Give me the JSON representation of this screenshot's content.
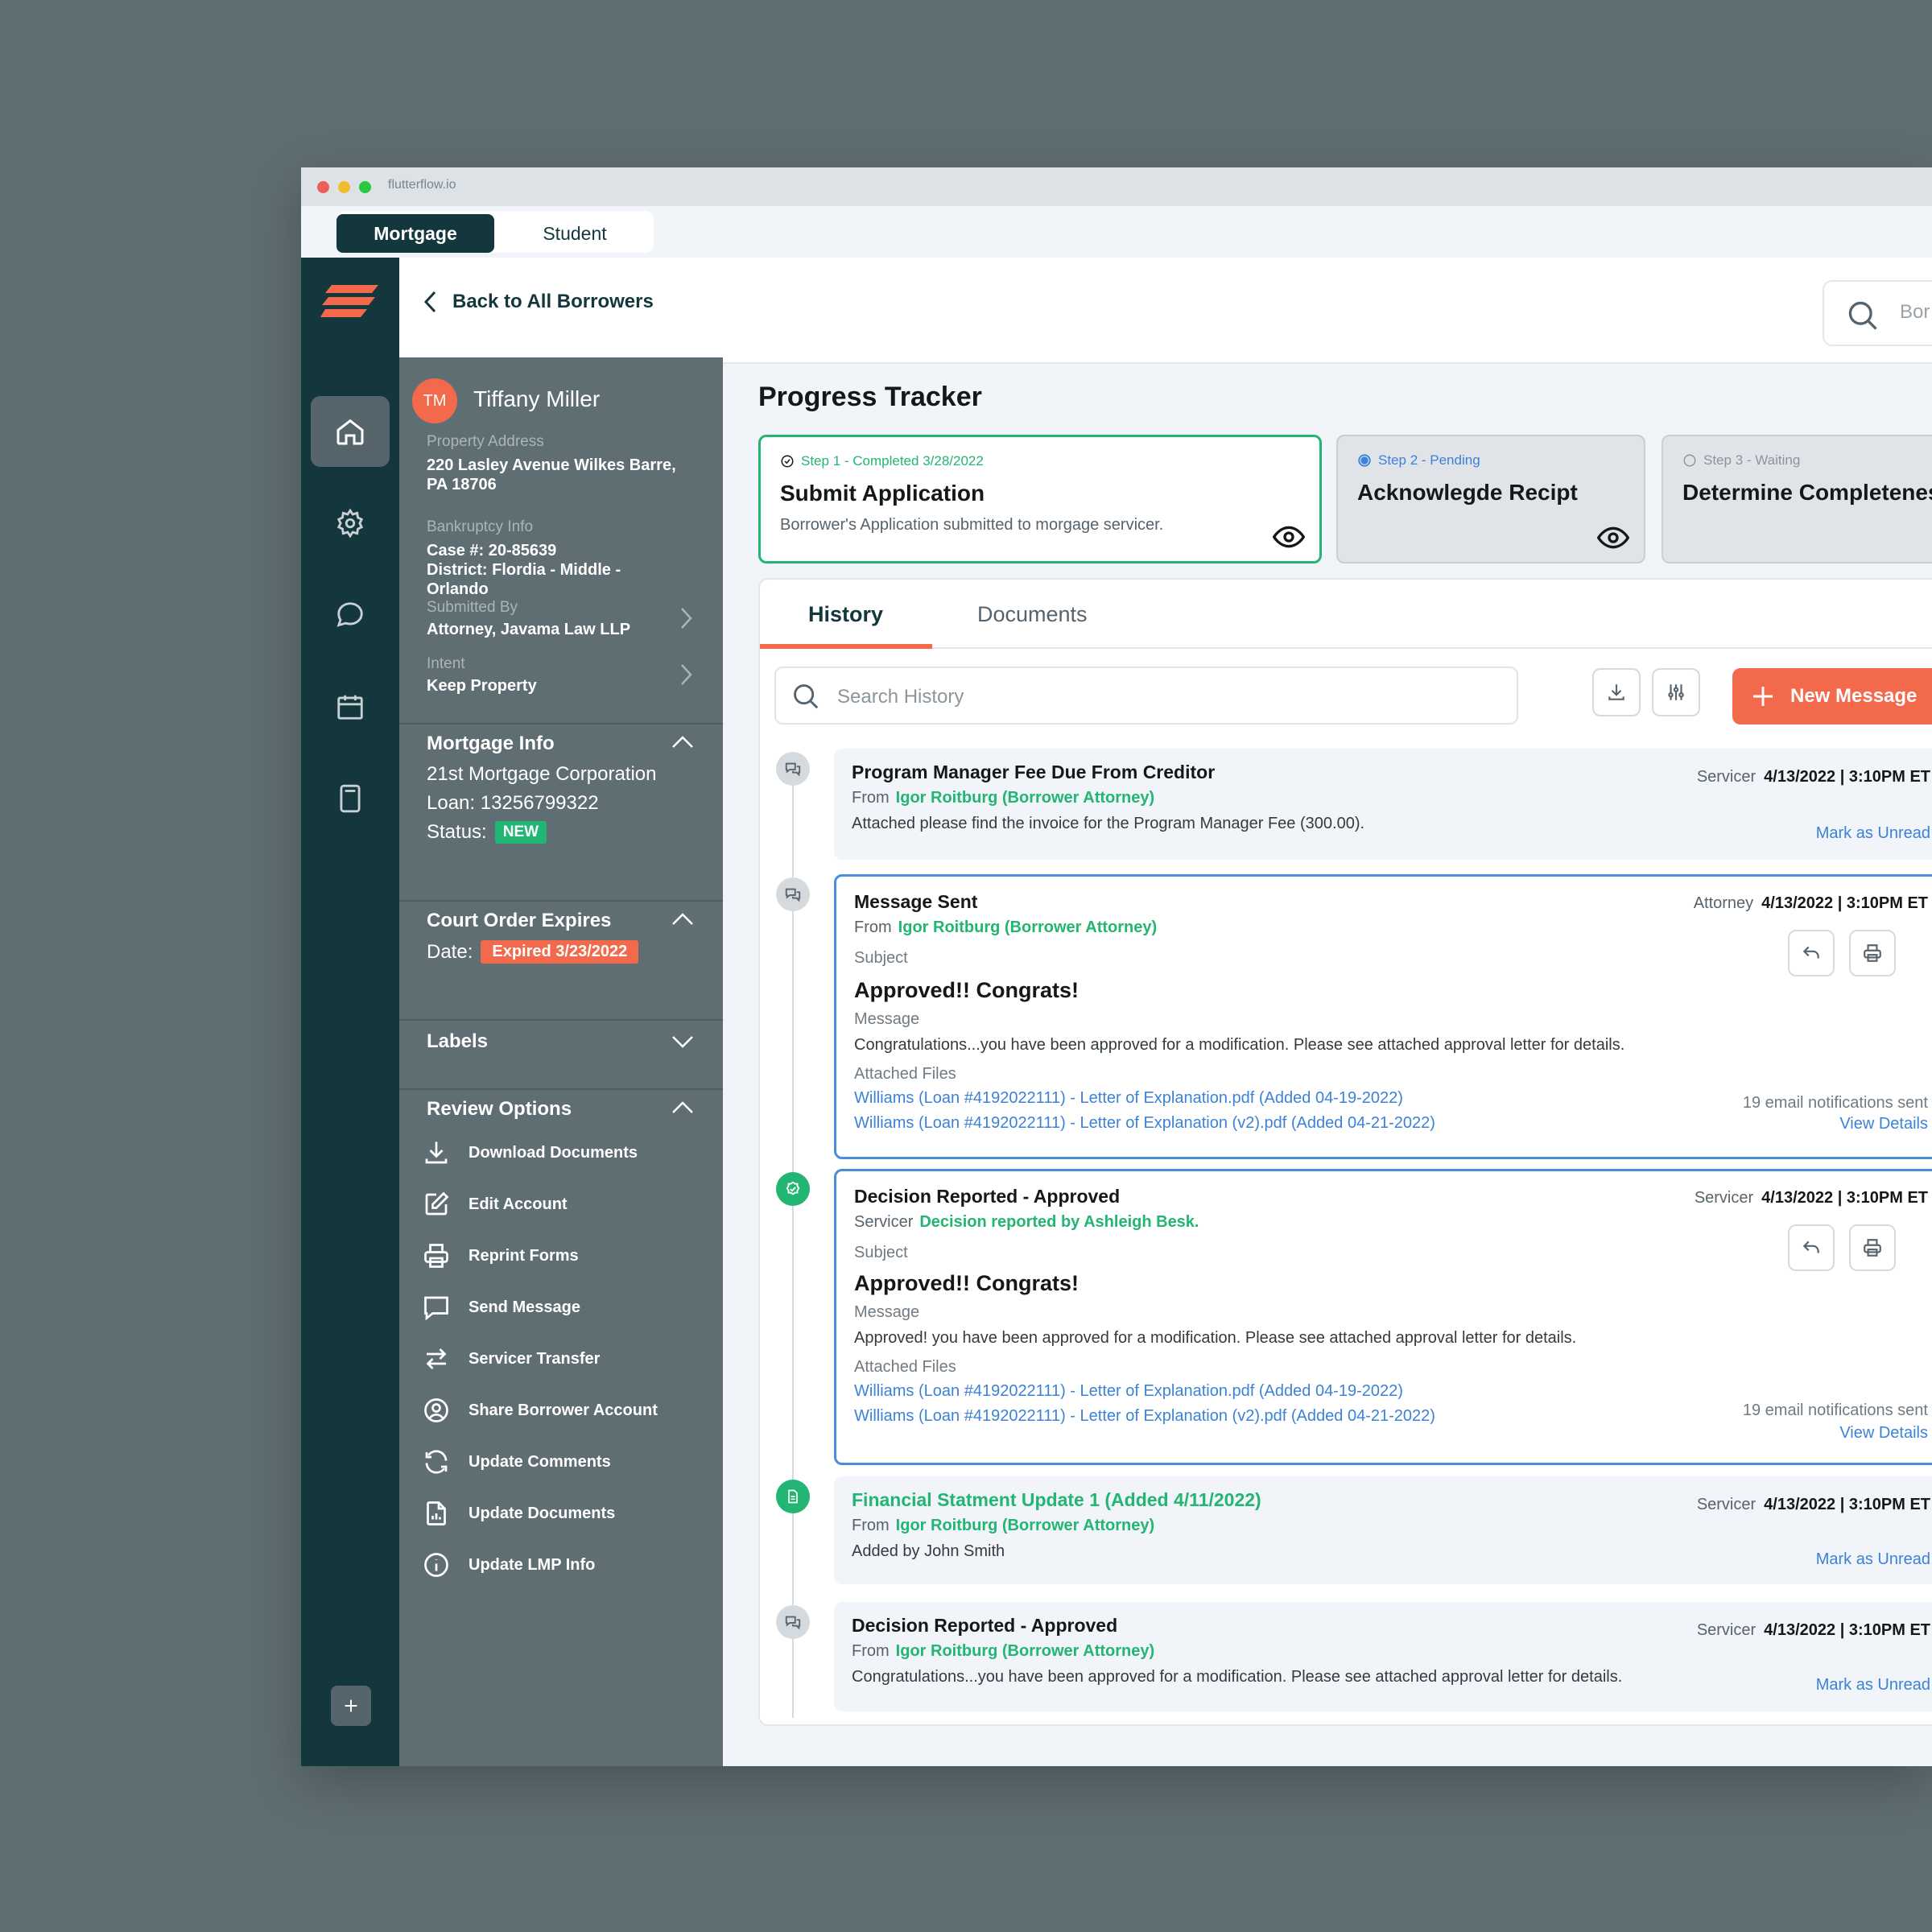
{
  "browser": {
    "url": "flutterflow.io"
  },
  "app_tabs": {
    "mortgage": "Mortgage",
    "student": "Student"
  },
  "header": {
    "back_label": "Back to All Borrowers",
    "search_placeholder": "Bor"
  },
  "borrower": {
    "initials": "TM",
    "name": "Tiffany Miller",
    "property_label": "Property Address",
    "property_line1": "220 Lasley Avenue Wilkes Barre,",
    "property_line2": "PA 18706",
    "bankruptcy_label": "Bankruptcy Info",
    "case": "Case #: 20-85639",
    "district_line1": "District: Flordia - Middle -",
    "district_line2": "Orlando",
    "submitted_label": "Submitted By",
    "submitted_value": "Attorney, Javama Law LLP",
    "intent_label": "Intent",
    "intent_value": "Keep Property"
  },
  "mortgage_info": {
    "title": "Mortgage Info",
    "company": "21st Mortgage Corporation",
    "loan": "Loan: 13256799322",
    "status_label": "Status:",
    "status_badge": "NEW"
  },
  "court_order": {
    "title": "Court Order Expires",
    "date_label": "Date:",
    "badge": "Expired 3/23/2022"
  },
  "labels_section": {
    "title": "Labels"
  },
  "review_options": {
    "title": "Review Options",
    "items": [
      {
        "label": "Download Documents",
        "icon": "download-icon"
      },
      {
        "label": "Edit Account",
        "icon": "edit-icon"
      },
      {
        "label": "Reprint Forms",
        "icon": "printer-icon"
      },
      {
        "label": "Send Message",
        "icon": "chat-icon"
      },
      {
        "label": "Servicer Transfer",
        "icon": "transfer-icon"
      },
      {
        "label": "Share Borrower Account",
        "icon": "user-circle-icon"
      },
      {
        "label": "Update Comments",
        "icon": "refresh-icon"
      },
      {
        "label": "Update Documents",
        "icon": "document-chart-icon"
      },
      {
        "label": "Update LMP Info",
        "icon": "info-icon"
      }
    ]
  },
  "progress": {
    "title": "Progress Tracker",
    "steps": [
      {
        "tag": "Step 1 - Completed 3/28/2022",
        "title": "Submit Application",
        "desc": "Borrower's Application submitted to morgage servicer.",
        "state": "completed"
      },
      {
        "tag": "Step 2 - Pending",
        "title": "Acknowlegde Recipt",
        "state": "pending"
      },
      {
        "tag": "Step 3 - Waiting",
        "title": "Determine Completenes",
        "state": "waiting"
      }
    ]
  },
  "history": {
    "tabs": [
      "History",
      "Documents"
    ],
    "search_placeholder": "Search History",
    "new_message": "New Message",
    "messages": [
      {
        "title": "Program Manager Fee Due From Creditor",
        "from_label": "From",
        "from": "Igor Roitburg (Borrower Attorney)",
        "role": "Servicer",
        "datetime": "4/13/2022  |  3:10PM ET",
        "body": "Attached please find the invoice for the Program Manager Fee (300.00).",
        "action": "Mark as Unread"
      },
      {
        "title": "Message Sent",
        "from_label": "From",
        "from": "Igor Roitburg (Borrower Attorney)",
        "role": "Attorney",
        "datetime": "4/13/2022  |  3:10PM ET",
        "subject_label": "Subject",
        "subject": "Approved!! Congrats!",
        "message_label": "Message",
        "body": "Congratulations...you have been approved for a modification.  Please see attached approval letter for details.",
        "files_label": "Attached Files",
        "files": [
          "Williams (Loan #4192022111) - Letter of Explanation.pdf (Added 04-19-2022)",
          "Williams (Loan #4192022111) - Letter of Explanation (v2).pdf (Added 04-21-2022)"
        ],
        "notifications": "19 email notifications sent",
        "view": "View Details"
      },
      {
        "title": "Decision Reported - Approved",
        "from_label": "Servicer",
        "from": "Decision reported by Ashleigh Besk.",
        "role": "Servicer",
        "datetime": "4/13/2022  |  3:10PM ET",
        "subject_label": "Subject",
        "subject": "Approved!! Congrats!",
        "message_label": "Message",
        "body": "Approved! you have been approved for a modification.  Please see attached approval letter for details.",
        "files_label": "Attached Files",
        "files": [
          "Williams (Loan #4192022111) - Letter of Explanation.pdf (Added 04-19-2022)",
          "Williams (Loan #4192022111) - Letter of Explanation (v2).pdf (Added 04-21-2022)"
        ],
        "notifications": "19 email notifications sent",
        "view": "View Details"
      },
      {
        "title": "Financial Statment Update 1 (Added 4/11/2022)",
        "from_label": "From",
        "from": "Igor Roitburg (Borrower Attorney)",
        "role": "Servicer",
        "datetime": "4/13/2022  |  3:10PM ET",
        "body": "Added by John Smith",
        "action": "Mark as Unread"
      },
      {
        "title": "Decision Reported - Approved",
        "from_label": "From",
        "from": "Igor Roitburg (Borrower Attorney)",
        "role": "Servicer",
        "datetime": "4/13/2022  |  3:10PM ET",
        "body": "Congratulations...you have been approved for a modification.  Please see attached approval letter for details.",
        "action": "Mark as Unread"
      }
    ]
  },
  "colors": {
    "rail": "#14363D",
    "panel": "#5F6E73",
    "accent": "#F26A4B",
    "success": "#22B573",
    "link": "#3C82D6"
  }
}
